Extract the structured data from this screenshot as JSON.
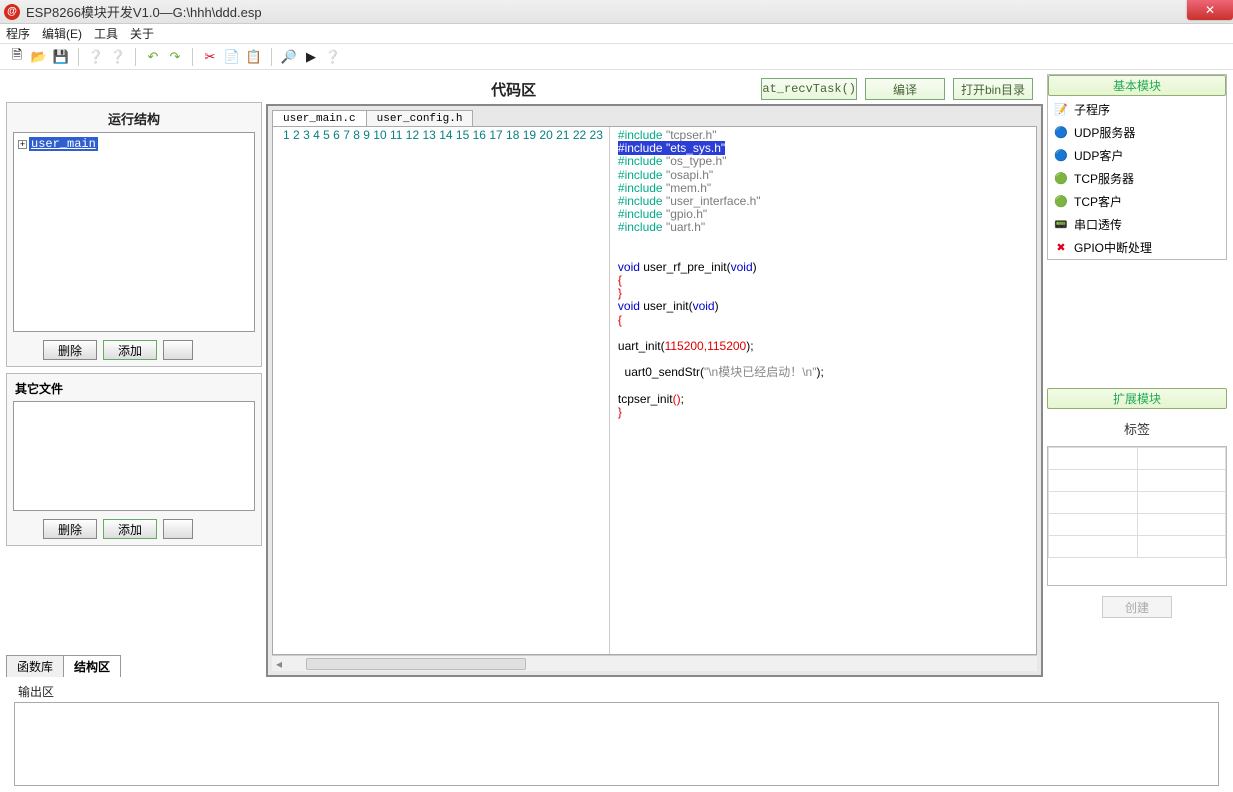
{
  "window": {
    "title": "ESP8266模块开发V1.0—G:\\hhh\\ddd.esp"
  },
  "menu": {
    "program": "程序",
    "edit": "编辑(E)",
    "tools": "工具",
    "about": "关于"
  },
  "toolbar_icons": {
    "new": "🗎",
    "open": "📂",
    "save": "💾",
    "help1": "❔",
    "help2": "❔",
    "undo": "↶",
    "redo": "↷",
    "cut": "✂",
    "copy": "📄",
    "paste": "📋",
    "find": "🔎",
    "play": "▶",
    "help3": "❔"
  },
  "left": {
    "run_struct_title": "运行结构",
    "tree_item": "user_main",
    "delete": "删除",
    "add": "添加",
    "other_files_title": "其它文件",
    "tab_funclib": "函数库",
    "tab_struct": "结构区"
  },
  "center": {
    "title": "代码区",
    "btn_recv": "at_recvTask()",
    "btn_compile": "编译",
    "btn_opendir": "打开bin目录",
    "tabs": {
      "t1": "user_main.c",
      "t2": "user_config.h"
    },
    "lines": [
      "1",
      "2",
      "3",
      "4",
      "5",
      "6",
      "7",
      "8",
      "9",
      "10",
      "11",
      "12",
      "13",
      "14",
      "15",
      "16",
      "17",
      "18",
      "19",
      "20",
      "21",
      "22",
      "23"
    ],
    "code": {
      "l1a": "#include",
      "l1b": "\"tcpser.h\"",
      "l2a": "#include",
      "l2b": "\"ets_sys.h\"",
      "l3a": "#include",
      "l3b": "\"os_type.h\"",
      "l4a": "#include",
      "l4b": "\"osapi.h\"",
      "l5a": "#include",
      "l5b": "\"mem.h\"",
      "l6a": "#include",
      "l6b": "\"user_interface.h\"",
      "l7a": "#include",
      "l7b": "\"gpio.h\"",
      "l8a": "#include",
      "l8b": "\"uart.h\"",
      "l11_void": "void",
      "l11_fn": " user_rf_pre_init(",
      "l11_v2": "void",
      "l11_end": ")",
      "l12": "{",
      "l13": "}",
      "l14_void": "void",
      "l14_fn": " user_init(",
      "l14_v2": "void",
      "l14_end": ")",
      "l15": "{",
      "l17_fn": "uart_init(",
      "l17_num": "115200,115200",
      "l17_end": ");",
      "l19_fn": "  uart0_sendStr(",
      "l19_str": "\"\\n模块已经启动！\\n\"",
      "l19_end": ");",
      "l21_fn": "tcpser_init",
      "l21_par": "()",
      "l21_end": ";",
      "l22": "}"
    }
  },
  "right": {
    "basic_title": "基本模块",
    "items": [
      "子程序",
      "UDP服务器",
      "UDP客户",
      "TCP服务器",
      "TCP客户",
      "串口透传",
      "GPIO中断处理"
    ],
    "icons": [
      "📝",
      "🔵",
      "🔵",
      "🟢",
      "🟢",
      "📟",
      "✖"
    ],
    "ext_title": "扩展模块",
    "tag_label": "标签",
    "create": "创建"
  },
  "output": {
    "label": "输出区"
  }
}
